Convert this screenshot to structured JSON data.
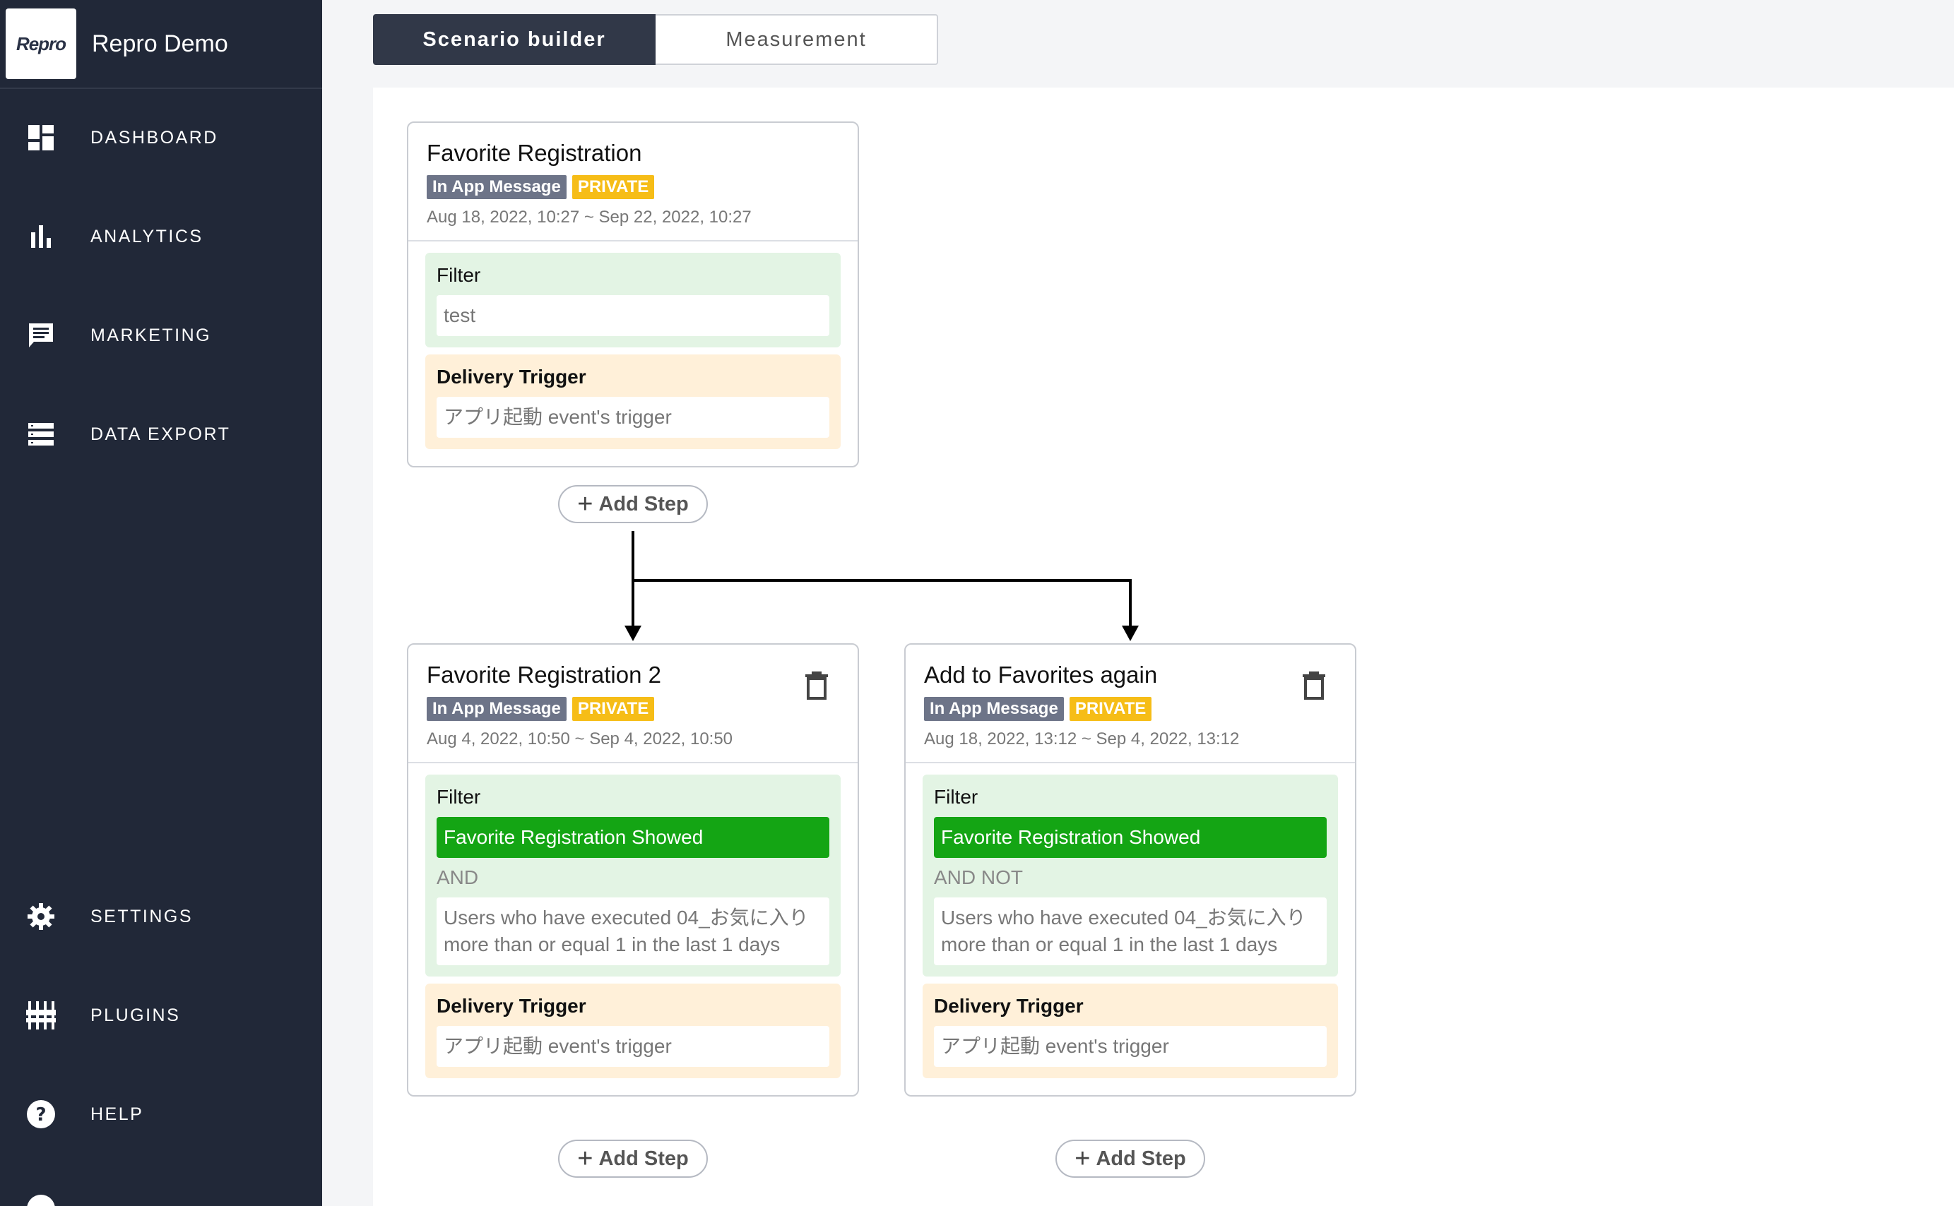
{
  "app": {
    "logo_text": "Repro",
    "name": "Repro Demo"
  },
  "sidebar": {
    "items": [
      {
        "label": "DASHBOARD",
        "icon": "dashboard-icon"
      },
      {
        "label": "ANALYTICS",
        "icon": "bar-chart-icon"
      },
      {
        "label": "MARKETING",
        "icon": "message-icon"
      },
      {
        "label": "DATA EXPORT",
        "icon": "list-icon"
      },
      {
        "label": "SETTINGS",
        "icon": "gear-icon"
      },
      {
        "label": "PLUGINS",
        "icon": "plugins-icon"
      },
      {
        "label": "HELP",
        "icon": "help-icon"
      }
    ]
  },
  "tabs": [
    {
      "label": "Scenario builder",
      "active": true
    },
    {
      "label": "Measurement",
      "active": false
    }
  ],
  "steps": [
    {
      "title": "Favorite Registration",
      "type_badge": "In App Message",
      "privacy_badge": "PRIVATE",
      "period": "Aug 18, 2022, 10:27 ~ Sep 22, 2022, 10:27",
      "filter_label": "Filter",
      "filter_value": "test",
      "trigger_label": "Delivery Trigger",
      "trigger_value": "アプリ起動 event's trigger",
      "add_step_label": "Add Step"
    },
    {
      "title": "Favorite Registration 2",
      "type_badge": "In App Message",
      "privacy_badge": "PRIVATE",
      "period": "Aug 4, 2022, 10:50 ~ Sep 4, 2022, 10:50",
      "filter_label": "Filter",
      "filter_event": "Favorite Registration Showed",
      "logic": "AND",
      "condition": "Users who have executed 04_お気に入り more than or equal 1 in the last 1 days",
      "trigger_label": "Delivery Trigger",
      "trigger_value": "アプリ起動 event's trigger",
      "add_step_label": "Add Step"
    },
    {
      "title": "Add to Favorites again",
      "type_badge": "In App Message",
      "privacy_badge": "PRIVATE",
      "period": "Aug 18, 2022, 13:12 ~ Sep 4, 2022, 13:12",
      "filter_label": "Filter",
      "filter_event": "Favorite Registration Showed",
      "logic": "AND NOT",
      "condition": "Users who have executed 04_お気に入り more than or equal 1 in the last 1 days",
      "trigger_label": "Delivery Trigger",
      "trigger_value": "アプリ起動 event's trigger",
      "add_step_label": "Add Step"
    }
  ],
  "colors": {
    "sidebar_bg": "#212838",
    "filter_bg": "#e3f4e4",
    "trigger_bg": "#fff0d9",
    "event_green": "#14a514",
    "private_badge": "#f6bd17",
    "type_badge": "#6d7488"
  }
}
